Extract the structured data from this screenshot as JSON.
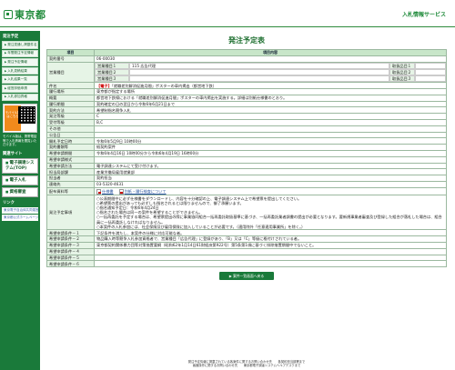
{
  "header": {
    "logo_text": "東京都",
    "service_name": "入札情報サービス"
  },
  "sidebar": {
    "section1_title": "発注予定",
    "links": [
      "発注見通し掲載件名",
      "年間発注予定情報",
      "発注予定情報",
      "入札見積結果",
      "入札結果一覧",
      "経営評価申請",
      "入札参加資格"
    ],
    "mobile_label": "モバイル版はこちら",
    "mobile_desc": "モバイル版は、携帯電話等で入札情報を閲覧いただけます。",
    "section2_title": "関連サイト",
    "big_buttons": [
      "電子調達システム(TOP)",
      "電子入札",
      "資格審査"
    ],
    "section3_title": "リンク",
    "bottom_links": [
      "東京電子自治体共同運営",
      "東京都公式ホームページ"
    ]
  },
  "main": {
    "title": "発注予定表",
    "columns": [
      "項目",
      "項目内容"
    ],
    "contract_no": {
      "label": "契約番号",
      "value": "06-00030"
    },
    "business_category": {
      "label": "営業種目",
      "rows": [
        {
          "sub_label": "営業種目１",
          "value": "115 広告代理",
          "no_label": "取扱品目１",
          "no_value": ""
        },
        {
          "sub_label": "営業種目２",
          "value": "",
          "no_label": "取扱品目２",
          "no_value": ""
        },
        {
          "sub_label": "営業種目３",
          "value": "",
          "no_label": "取扱品目３",
          "no_value": ""
        }
      ]
    },
    "subject": {
      "label": "件名",
      "tag": "【電子】",
      "value": "「就職差別解消促進月間」ポスターの車内掲出（都営地下鉄）"
    },
    "location": {
      "label": "履行場所",
      "value": "東京都が指定する場所"
    },
    "summary": {
      "label": "概要",
      "value": "都営地下鉄線における「就職差別解消促進月間」ポスターの車内掲出を実施する。詳細は別紙仕様書のとおり。"
    },
    "period": {
      "label": "履行期間",
      "value": "契約確定の日の翌日から令和6年6月21日まで"
    },
    "method": {
      "label": "契約方法",
      "value": "希望制指名競争入札"
    },
    "grade": {
      "label": "発注等級",
      "value": "C"
    },
    "grade2": {
      "label": "受付等級",
      "value": "B,C"
    },
    "other": {
      "label": "その他",
      "value": ""
    },
    "announce_date": {
      "label": "公告日",
      "value": ""
    },
    "open_date": {
      "label": "開札予定日時",
      "value": "令和6年5月9日 10時00分"
    },
    "reception_form": {
      "label": "契約書類等",
      "value": "紙契約案件"
    },
    "apply_period": {
      "label": "希望申請期間",
      "value": "令和6年4月16日 10時00分から令和6年4月19日 16時00分"
    },
    "apply_form": {
      "label": "希望申請様式",
      "value": ""
    },
    "apply_method": {
      "label": "希望申請方法",
      "value": "電子調達システムにて受け付けます。"
    },
    "dept": {
      "label": "担当局部課",
      "value": "産業労働局雇用就業部"
    },
    "person": {
      "label": "担当者",
      "value": "契約担当"
    },
    "contact": {
      "label": "連絡先",
      "value": "03-5320-4631"
    },
    "files": {
      "label": "配布資料等",
      "file1": "仕様書",
      "file2": "別紙・履行検査について"
    },
    "conditions": {
      "label": "発注予定事項",
      "lines": [
        "○公表期間中に必ず仕様書をダウンロードし、内容を十分確認の上、電子調達システム上で希望票を提出してください。",
        "○希望票の提出があっても必ずしも指名されるとは限りませんので、御了承願います。",
        "○指名通知予定日：令和6年4月24日",
        "○指名された場合は同一の案件を希望することができません。",
        "○一括再委託を予定する場合は、希望票提出の際に事業協同組合一括再委託取扱基準に基づき、一括再委託業者調書の提出が必要となります。要新規事業者審査及び登録した組合が落札した場合は、組合員に一括再委託しなければなりません。",
        "○本案件の入札参加には、社会保険及び雇用保険に加入していることが必要です。（適用除外「任意適用事業所」を除く。）"
      ]
    },
    "req1": {
      "label": "希望申請条件－１",
      "value": "下記条件を満たし、本案件の仕様に対応可能な者。"
    },
    "req2": {
      "label": "希望申請条件－２",
      "value": "物品購入時等競争入札参加資格者で、営業種目「広告代理」に登録があり、「B」又は「C」等級に格付けされている者。"
    },
    "req3": {
      "label": "希望申請条件－３",
      "value": "東京都契約関係暴力団等対策措置要綱（昭和62年1月14日61財経庶第922号）第5条第1項に基づく排除措置期間中でないこと。"
    },
    "req4": {
      "label": "希望申請条件－４",
      "value": ""
    },
    "req5": {
      "label": "希望申請条件－５",
      "value": ""
    },
    "req6": {
      "label": "希望申請条件－６",
      "value": ""
    },
    "back_button": "案件一覧画面へ戻る"
  },
  "footer": {
    "line1": "発注予定情報に掲載されている各案件に関するお問い合わせ先　　各契約担当部署まで",
    "line2": "画面操作に関するお問い合わせ先　　東京都電子調達システムヘルプデスクまで"
  }
}
